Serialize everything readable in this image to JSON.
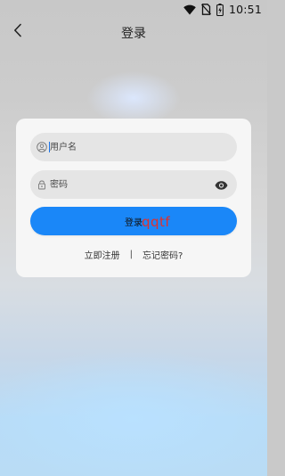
{
  "status_bar": {
    "time": "10:51",
    "icons": [
      "wifi-icon",
      "no-sim-icon",
      "battery-charging-icon"
    ]
  },
  "header": {
    "title": "登录",
    "back_icon": "chevron-left-icon"
  },
  "login_form": {
    "username": {
      "placeholder": "用户名",
      "value": "",
      "icon": "user-icon"
    },
    "password": {
      "placeholder": "密码",
      "value": "",
      "icon": "lock-icon",
      "toggle_icon": "eye-icon"
    },
    "submit_label": "登录",
    "register_link": "立即注册",
    "separator": "|",
    "forgot_link": "忘记密码?"
  },
  "watermark": "qqtf",
  "colors": {
    "primary": "#1a87f8",
    "card": "#f6f6f6",
    "field": "#e5e5e5",
    "watermark": "#e0312c"
  }
}
